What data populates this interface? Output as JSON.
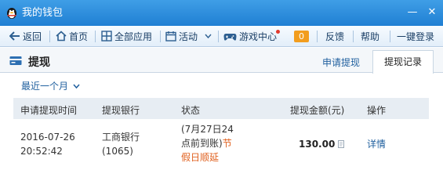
{
  "window": {
    "title": "我的钱包",
    "minimize_glyph": "—",
    "close_glyph": "✕"
  },
  "toolbar": {
    "back_label": "返回",
    "home_label": "首页",
    "all_apps_label": "全部应用",
    "activity_label": "活动",
    "game_center_label": "游戏中心",
    "notification_count": "0",
    "feedback_label": "反馈",
    "help_label": "帮助",
    "login_label": "一键登录"
  },
  "header": {
    "title": "提现",
    "tab_apply": "申请提现",
    "tab_records": "提现记录"
  },
  "filter": {
    "selected": "最近一个月"
  },
  "table": {
    "columns": [
      "申请提现时间",
      "提现银行",
      "状态",
      "提现金额(元)",
      "操作"
    ],
    "rows": [
      {
        "date": "2016-07-26",
        "time": "20:52:42",
        "bank_name": "工商银行",
        "bank_tail": "(1065)",
        "status_line1": "(7月27日24",
        "status_line2_black": "点前到账)",
        "status_line2_orange": "节",
        "status_line3": "假日顺延",
        "amount": "130.00",
        "action": "详情"
      }
    ]
  },
  "colors": {
    "title_bar": "#1f7fd3",
    "link": "#1f5f9e",
    "badge": "#f29d1e",
    "status_warning": "#e0611f"
  },
  "icons": [
    "qq-penguin-icon",
    "back-arrow-icon",
    "home-icon",
    "grid-icon",
    "calendar-icon",
    "chevron-down-icon",
    "gamepad-icon",
    "wallet-icon",
    "note-icon"
  ]
}
